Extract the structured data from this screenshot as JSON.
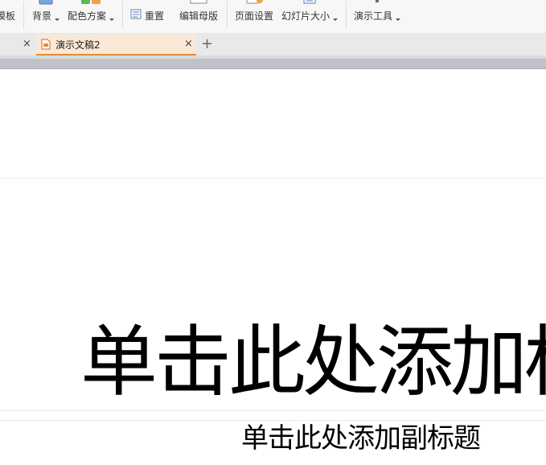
{
  "ribbon": {
    "items": [
      {
        "label": "模板",
        "has_dropdown": false
      },
      {
        "label": "背景",
        "has_dropdown": true
      },
      {
        "label": "配色方案",
        "has_dropdown": true
      },
      {
        "label": "重置",
        "has_dropdown": false
      },
      {
        "label": "编辑母版",
        "has_dropdown": false
      },
      {
        "label": "页面设置",
        "has_dropdown": false
      },
      {
        "label": "幻灯片大小",
        "has_dropdown": true
      },
      {
        "label": "演示工具",
        "has_dropdown": true
      }
    ]
  },
  "tabs": {
    "items": [
      {
        "label": "",
        "active": false
      },
      {
        "label": "演示文稿2",
        "active": true
      }
    ],
    "close_glyph": "×",
    "new_tab_glyph": "+"
  },
  "slide": {
    "title_placeholder": "单击此处添加标题",
    "subtitle_placeholder": "单击此处添加副标题"
  },
  "colors": {
    "ribbon_bg": "#f7f7f7",
    "active_tab_bg": "#fbe8d6",
    "active_tab_accent": "#e58b3a",
    "separator_band": "#bfc3c8"
  },
  "icons": [
    "template-icon",
    "background-icon",
    "color-scheme-icon",
    "reset-icon",
    "edit-master-icon",
    "page-setup-icon",
    "slide-size-icon",
    "presentation-tools-icon",
    "document-icon",
    "close-icon",
    "plus-icon"
  ]
}
